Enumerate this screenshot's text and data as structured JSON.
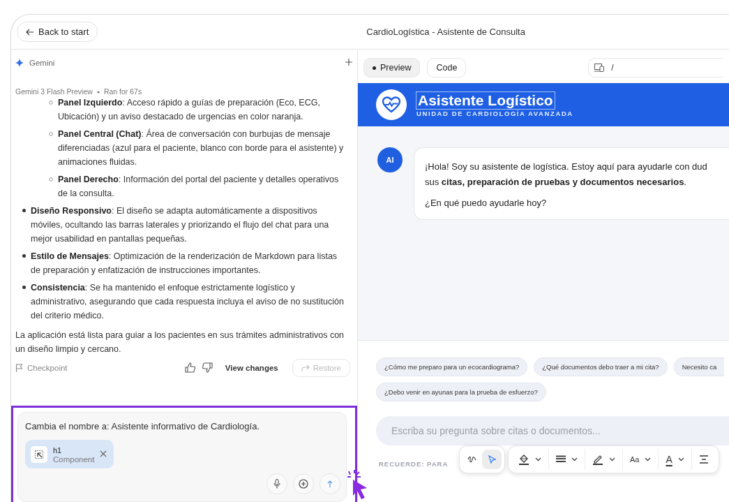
{
  "top_bar": {
    "back_button": "Back to start",
    "title": "CardioLogística - Asistente de Consulta"
  },
  "gemini_panel": {
    "title": "Gemini",
    "model": "Gemini 3 Flash Preview",
    "run_time": "Ran for 67s",
    "sub_items": [
      "**Panel Izquierdo**: Acceso rápido a guías de preparación (Eco, ECG, Ubicación) y un aviso destacado de urgencias en color naranja.",
      "**Panel Central (Chat)**: Área de conversación con burbujas de mensaje diferenciadas (azul para el paciente, blanco con borde para el asistente) y animaciones fluidas.",
      "**Panel Derecho**: Información del portal del paciente y detalles operativos de la consulta."
    ],
    "items": [
      "**Diseño Responsivo**: El diseño se adapta automáticamente a dispositivos móviles, ocultando las barras laterales y priorizando el flujo del chat para una mejor usabilidad en pantallas pequeñas.",
      "**Estilo de Mensajes**: Optimización de la renderización de Markdown para listas de preparación y enfatización de instrucciones importantes.",
      "**Consistencia**: Se ha mantenido el enfoque estrictamente logístico y administrativo, asegurando que cada respuesta incluya el aviso de no sustitución del criterio médico."
    ],
    "closing": "La aplicación está lista para guiar a los pacientes en sus trámites administrativos con un diseño limpio y cercano.",
    "checkpoint": "Checkpoint",
    "view_changes": "View changes",
    "restore": {
      "label": "Restore",
      "disabled": true
    },
    "prompt": {
      "value": "Cambia el nombre a: Asistente informativo de Cardiología.",
      "attachment": {
        "tag": "h1",
        "type": "Component"
      }
    }
  },
  "preview": {
    "tabs": [
      {
        "label": "Preview",
        "selected": true
      },
      {
        "label": "Code",
        "selected": false
      }
    ],
    "address": "/",
    "app": {
      "title": "Asistente Logístico",
      "subtitle": "UNIDAD DE CARDIOLOGÍA AVANZADA",
      "message": {
        "avatar": "AI",
        "lines": [
          "¡Hola! Soy su asistente de logística. Estoy aquí para ayudarle con dud",
          "sus **citas, preparación de pruebas y documentos necesarios**."
        ],
        "question": "¿En qué puedo ayudarle hoy?"
      },
      "suggestions": [
        "¿Cómo me preparo para un ecocardiograma?",
        "¿Qué documentos debo traer a mi cita?",
        "Necesito ca",
        "¿Debo venir en ayunas para la prueba de esfuerzo?"
      ],
      "input_placeholder": "Escriba su pregunta sobre citas o documentos...",
      "footer_note": "RECUERDE: PARA"
    },
    "toolbar": {
      "mode_tools": [
        {
          "kind": "draw",
          "selected": false
        },
        {
          "kind": "select",
          "selected": true
        }
      ],
      "format_tools": [
        {
          "kind": "fill"
        },
        {
          "kind": "line-weight"
        },
        {
          "kind": "pen"
        },
        {
          "kind": "font-size",
          "label": "Aa"
        },
        {
          "kind": "font-color",
          "label": "A"
        },
        {
          "kind": "align"
        }
      ]
    }
  }
}
